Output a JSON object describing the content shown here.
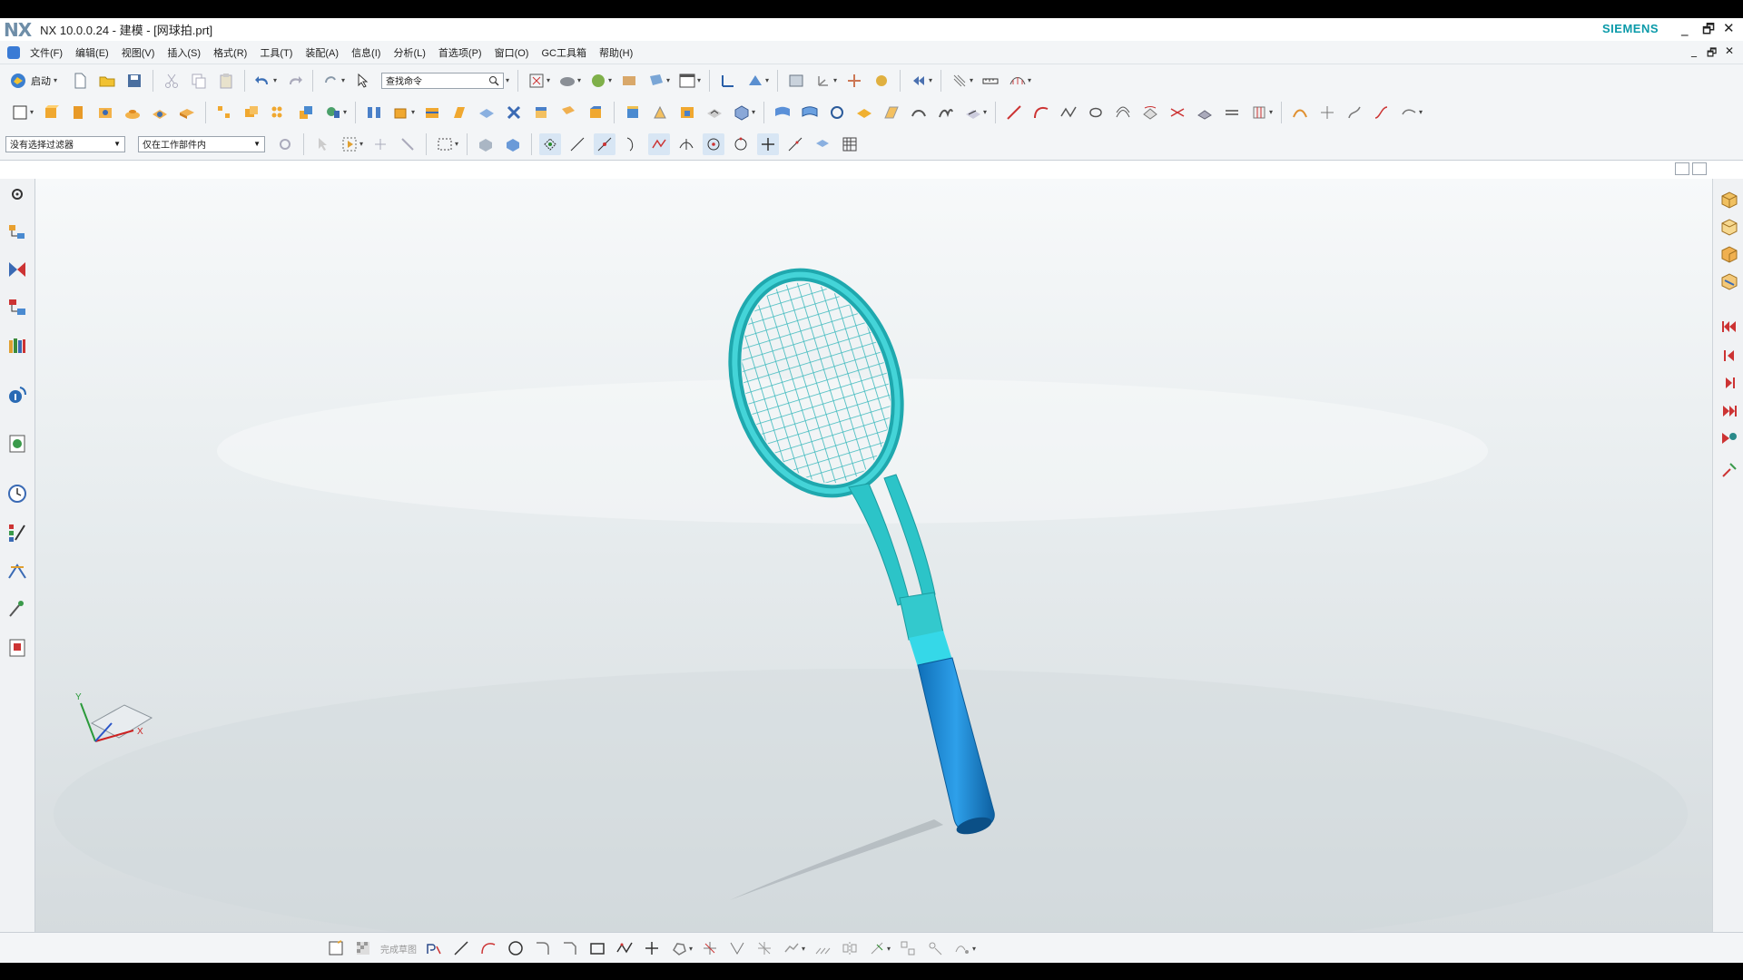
{
  "window": {
    "app_logo": "NX",
    "title": "NX 10.0.0.24 - 建模 - [网球拍.prt]",
    "brand": "SIEMENS",
    "controls": {
      "minimize": "_",
      "restore": "🗗",
      "close": "✕"
    },
    "doc_controls": {
      "minimize": "_",
      "restore": "🗗",
      "close": "✕"
    }
  },
  "menubar": {
    "items": [
      "文件(F)",
      "编辑(E)",
      "视图(V)",
      "插入(S)",
      "格式(R)",
      "工具(T)",
      "装配(A)",
      "信息(I)",
      "分析(L)",
      "首选项(P)",
      "窗口(O)",
      "GC工具箱",
      "帮助(H)"
    ]
  },
  "toolbar": {
    "start_label": "启动",
    "search_placeholder": "查找命令"
  },
  "selection": {
    "filter": "没有选择过滤器",
    "scope": "仅在工作部件内"
  },
  "bottom_toolbar": {
    "sketch_label": "完成草图"
  },
  "triad": {
    "x_label": "X",
    "y_label": "Y"
  },
  "colors": {
    "racket_frame": "#2cc4c8",
    "racket_grip": "#1a8ad4",
    "brand": "#0a9aa9",
    "viewport_bg": "#e9eef0"
  }
}
